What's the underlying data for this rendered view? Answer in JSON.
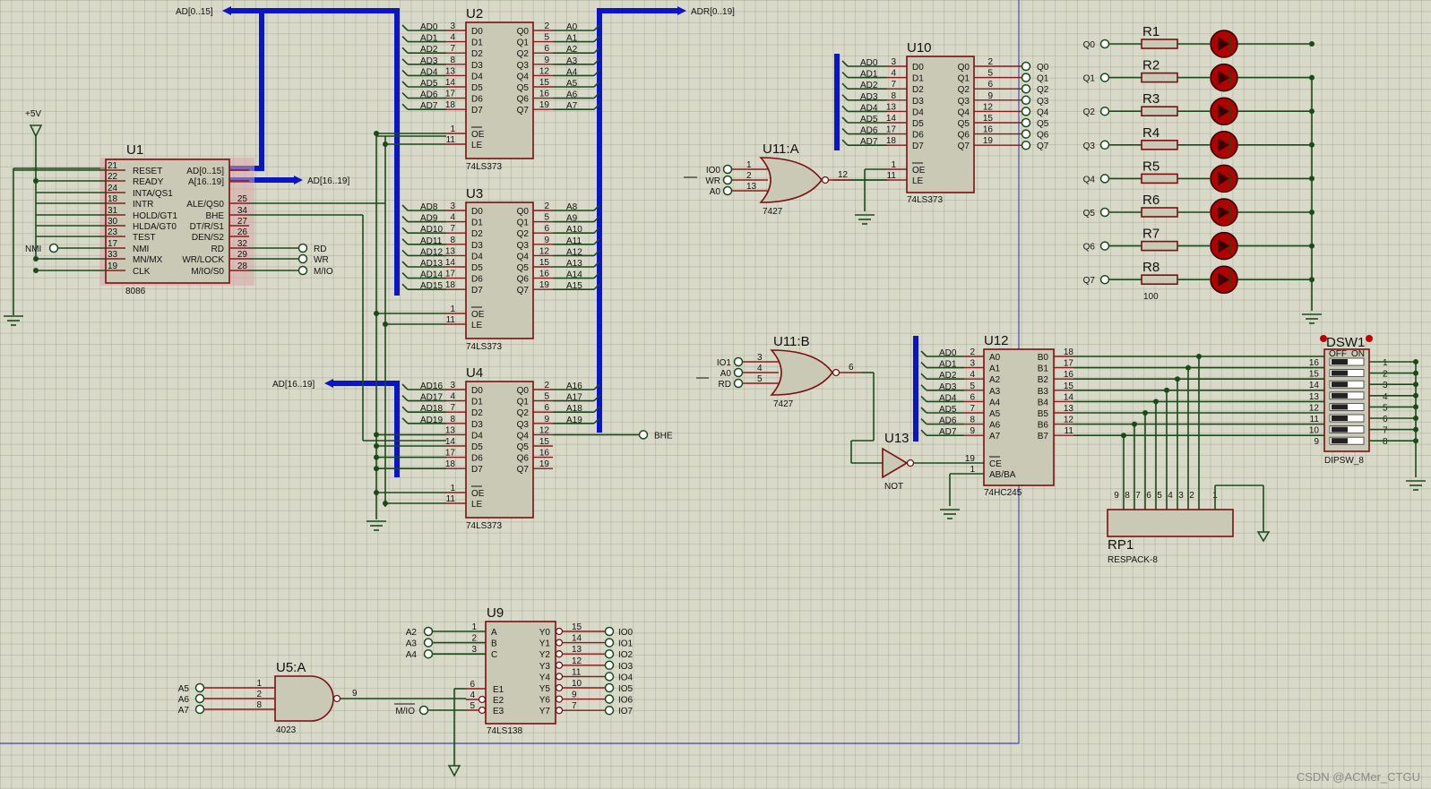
{
  "watermark": "CSDN @ACMer_CTGU",
  "colors": {
    "bus": "#0a14c8",
    "wire": "#1a4a1a",
    "chip_border": "#7a1010",
    "chip_fill": "#c9c9b6",
    "led": "#b00000",
    "background": "#d9d9c9"
  },
  "power": {
    "vcc": "+5V"
  },
  "bus_labels": {
    "ad_0_15": "AD[0..15]",
    "adr_0_19": "ADR[0..19]",
    "ad_16_19": "AD[16..19]",
    "ad_16_19_b": "AD[16..19]"
  },
  "u1": {
    "ref": "U1",
    "part": "8086",
    "left_pins": [
      {
        "num": "21",
        "name": "RESET"
      },
      {
        "num": "22",
        "name": "READY"
      },
      {
        "num": "24",
        "name": "INTA/QS1"
      },
      {
        "num": "18",
        "name": "INTR"
      },
      {
        "num": "31",
        "name": "HOLD/GT1"
      },
      {
        "num": "30",
        "name": "HLDA/GT0"
      },
      {
        "num": "23",
        "name": "TEST"
      },
      {
        "num": "17",
        "name": "NMI"
      },
      {
        "num": "33",
        "name": "MN/MX"
      },
      {
        "num": "19",
        "name": "CLK"
      }
    ],
    "right_pins": [
      {
        "num": "",
        "name": "AD[0..15]"
      },
      {
        "num": "",
        "name": "A[16..19]"
      },
      {
        "num": "25",
        "name": "ALE/QS0"
      },
      {
        "num": "34",
        "name": "BHE"
      },
      {
        "num": "27",
        "name": "DT/R/S1"
      },
      {
        "num": "26",
        "name": "DEN/S2"
      },
      {
        "num": "32",
        "name": "RD"
      },
      {
        "num": "29",
        "name": "WR/LOCK"
      },
      {
        "num": "28",
        "name": "M/IO/S0"
      }
    ],
    "nmi_label": "NMI",
    "out_rd": "RD",
    "out_wr": "WR",
    "out_mio": "M/IO"
  },
  "latches": [
    {
      "ref": "U2",
      "part": "74LS373",
      "in": [
        "AD0",
        "AD1",
        "AD2",
        "AD3",
        "AD4",
        "AD5",
        "AD6",
        "AD7"
      ],
      "in_pins": [
        "3",
        "4",
        "7",
        "8",
        "13",
        "14",
        "17",
        "18"
      ],
      "out": [
        "A0",
        "A1",
        "A2",
        "A3",
        "A4",
        "A5",
        "A6",
        "A7"
      ],
      "out_pins": [
        "2",
        "5",
        "6",
        "9",
        "12",
        "15",
        "16",
        "19"
      ]
    },
    {
      "ref": "U3",
      "part": "74LS373",
      "in": [
        "AD8",
        "AD9",
        "AD10",
        "AD11",
        "AD12",
        "AD13",
        "AD14",
        "AD15"
      ],
      "in_pins": [
        "3",
        "4",
        "7",
        "8",
        "13",
        "14",
        "17",
        "18"
      ],
      "out": [
        "A8",
        "A9",
        "A10",
        "A11",
        "A12",
        "A13",
        "A14",
        "A15"
      ],
      "out_pins": [
        "2",
        "5",
        "6",
        "9",
        "12",
        "15",
        "16",
        "19"
      ]
    },
    {
      "ref": "U4",
      "part": "74LS373",
      "in": [
        "AD16",
        "AD17",
        "AD18",
        "AD19",
        "",
        "",
        "",
        ""
      ],
      "in_pins": [
        "3",
        "4",
        "7",
        "8",
        "13",
        "14",
        "17",
        "18"
      ],
      "out": [
        "A16",
        "A17",
        "A18",
        "A19",
        "",
        "",
        "",
        ""
      ],
      "out_pins": [
        "2",
        "5",
        "6",
        "9",
        "12",
        "15",
        "16",
        "19"
      ]
    }
  ],
  "latch_pin_names": {
    "d": [
      "D0",
      "D1",
      "D2",
      "D3",
      "D4",
      "D5",
      "D6",
      "D7"
    ],
    "q": [
      "Q0",
      "Q1",
      "Q2",
      "Q3",
      "Q4",
      "Q5",
      "Q6",
      "Q7"
    ],
    "oe": "OE",
    "le": "LE",
    "oe_pin": "1",
    "le_pin": "11"
  },
  "bhe_out": "BHE",
  "u10": {
    "ref": "U10",
    "part": "74LS373",
    "in": [
      "AD0",
      "AD1",
      "AD2",
      "AD3",
      "AD4",
      "AD5",
      "AD6",
      "AD7"
    ],
    "in_pins": [
      "3",
      "4",
      "7",
      "8",
      "13",
      "14",
      "17",
      "18"
    ],
    "out": [
      "Q0",
      "Q1",
      "Q2",
      "Q3",
      "Q4",
      "Q5",
      "Q6",
      "Q7"
    ],
    "out_pins": [
      "2",
      "5",
      "6",
      "9",
      "12",
      "15",
      "16",
      "19"
    ]
  },
  "u11a": {
    "ref": "U11:A",
    "part": "7427",
    "inputs": [
      "IO0",
      "WR",
      "A0"
    ],
    "in_pins": [
      "1",
      "2",
      "13"
    ],
    "out_pin": "12"
  },
  "u11b": {
    "ref": "U11:B",
    "part": "7427",
    "inputs": [
      "IO1",
      "A0",
      "RD"
    ],
    "in_pins": [
      "3",
      "4",
      "5"
    ],
    "out_pin": "6"
  },
  "u13": {
    "ref": "U13",
    "part": "NOT"
  },
  "u12": {
    "ref": "U12",
    "part": "74HC245",
    "in": [
      "AD0",
      "AD1",
      "AD2",
      "AD3",
      "AD4",
      "AD5",
      "AD6",
      "AD7"
    ],
    "a_names": [
      "A0",
      "A1",
      "A2",
      "A3",
      "A4",
      "A5",
      "A6",
      "A7"
    ],
    "a_pins": [
      "2",
      "3",
      "4",
      "5",
      "6",
      "7",
      "8",
      "9"
    ],
    "b_names": [
      "B0",
      "B1",
      "B2",
      "B3",
      "B4",
      "B5",
      "B6",
      "B7"
    ],
    "b_pins": [
      "18",
      "17",
      "16",
      "15",
      "14",
      "13",
      "12",
      "11"
    ],
    "ce": "CE",
    "abba": "AB/BA",
    "ce_pin": "19",
    "ab_pin": "1"
  },
  "leds": {
    "inputs": [
      "Q0",
      "Q1",
      "Q2",
      "Q3",
      "Q4",
      "Q5",
      "Q6",
      "Q7"
    ],
    "resistors": [
      "R1",
      "R2",
      "R3",
      "R4",
      "R5",
      "R6",
      "R7",
      "R8"
    ],
    "value": "100"
  },
  "dsw": {
    "ref": "DSW1",
    "part": "DIPSW_8",
    "left_pins": [
      "16",
      "15",
      "14",
      "13",
      "12",
      "11",
      "10",
      "9"
    ],
    "right_pins": [
      "1",
      "2",
      "3",
      "4",
      "5",
      "6",
      "7",
      "8"
    ],
    "off": "OFF",
    "on": "ON"
  },
  "rp1": {
    "ref": "RP1",
    "part": "RESPACK-8",
    "pins": [
      "9",
      "8",
      "7",
      "6",
      "5",
      "4",
      "3",
      "2",
      "1"
    ]
  },
  "u9": {
    "ref": "U9",
    "part": "74LS138",
    "inputs": [
      "A2",
      "A3",
      "A4"
    ],
    "in_names": [
      "A",
      "B",
      "C"
    ],
    "in_pins": [
      "1",
      "2",
      "3"
    ],
    "en_names": [
      "E1",
      "E2",
      "E3"
    ],
    "en_pins": [
      "6",
      "4",
      "5"
    ],
    "outputs": [
      "IO0",
      "IO1",
      "IO2",
      "IO3",
      "IO4",
      "IO5",
      "IO6",
      "IO7"
    ],
    "out_names": [
      "Y0",
      "Y1",
      "Y2",
      "Y3",
      "Y4",
      "Y5",
      "Y6",
      "Y7"
    ],
    "out_pins": [
      "15",
      "14",
      "13",
      "12",
      "11",
      "10",
      "9",
      "7"
    ],
    "mio": "M/IO"
  },
  "u5a": {
    "ref": "U5:A",
    "part": "4023",
    "inputs": [
      "A5",
      "A6",
      "A7"
    ],
    "in_pins": [
      "1",
      "2",
      "8"
    ],
    "out_pin": "9"
  }
}
